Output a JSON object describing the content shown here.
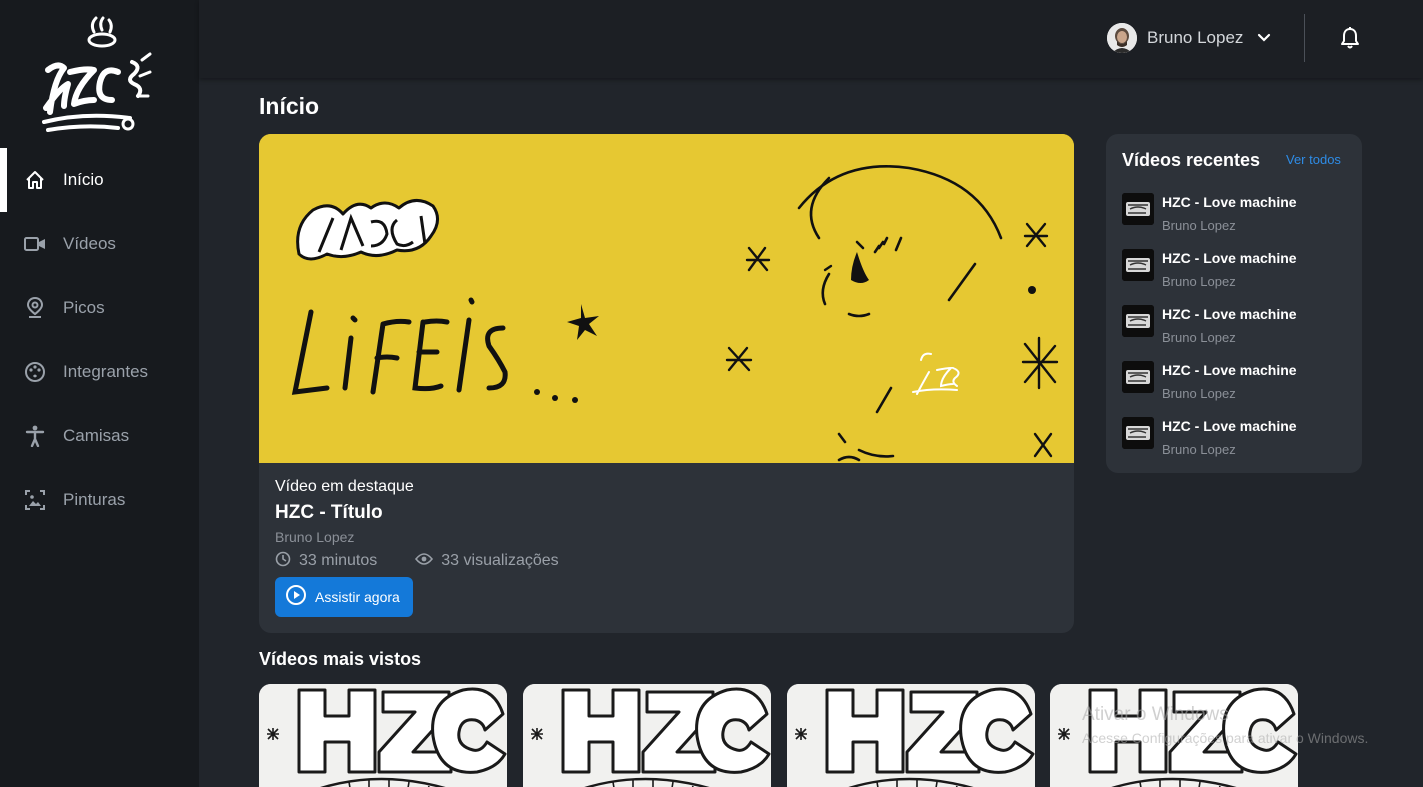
{
  "sidebar": {
    "items": [
      {
        "label": "Início",
        "icon": "home-icon"
      },
      {
        "label": "Vídeos",
        "icon": "video-camera-icon"
      },
      {
        "label": "Picos",
        "icon": "map-pin-icon"
      },
      {
        "label": "Integrantes",
        "icon": "palette-icon"
      },
      {
        "label": "Camisas",
        "icon": "person-icon"
      },
      {
        "label": "Pinturas",
        "icon": "image-icon"
      }
    ]
  },
  "header": {
    "user_name": "Bruno Lopez"
  },
  "page": {
    "title": "Início"
  },
  "featured": {
    "kicker": "Vídeo em destaque",
    "title": "HZC - Título",
    "author": "Bruno Lopez",
    "duration": "33 minutos",
    "views": "33 visualizações",
    "button_label": "Assistir agora",
    "banner_text": "LIFE IS ..."
  },
  "recent": {
    "title": "Vídeos recentes",
    "see_all": "Ver todos",
    "items": [
      {
        "title": "HZC - Love machine",
        "author": "Bruno Lopez"
      },
      {
        "title": "HZC - Love machine",
        "author": "Bruno Lopez"
      },
      {
        "title": "HZC - Love machine",
        "author": "Bruno Lopez"
      },
      {
        "title": "HZC - Love machine",
        "author": "Bruno Lopez"
      },
      {
        "title": "HZC - Love machine",
        "author": "Bruno Lopez"
      }
    ]
  },
  "most_viewed": {
    "title": "Vídeos mais vistos",
    "thumb_text": "HZC"
  },
  "watermark": {
    "line1": "Ativar o Windows",
    "line2": "Acesse Configurações para ativar o Windows."
  },
  "colors": {
    "accent": "#1479d9",
    "banner": "#e6c832",
    "sidebar": "#171a1e",
    "card": "#2d3239"
  }
}
